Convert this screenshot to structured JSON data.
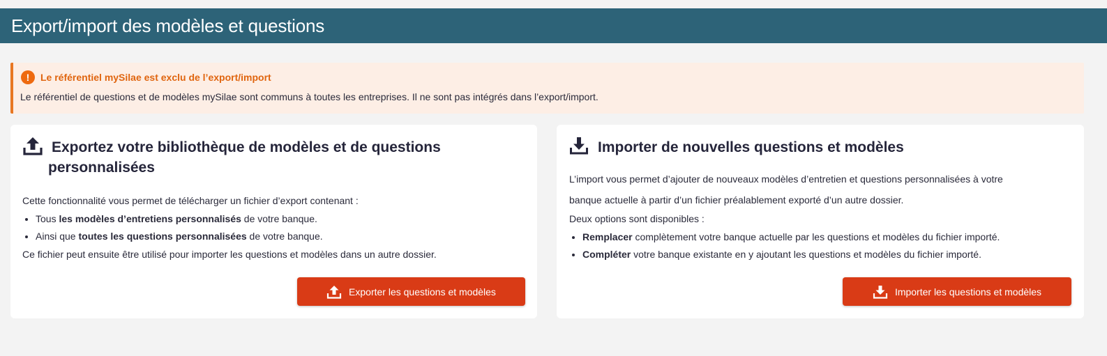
{
  "header": {
    "title": "Export/import des modèles et questions"
  },
  "alert": {
    "title": "Le référentiel mySilae est exclu de l’export/import",
    "text": "Le référentiel de questions et de modèles mySilae sont communs à toutes les entreprises. Il ne sont pas intégrés dans l’export/import.",
    "icon": "exclamation-circle-icon",
    "accent_color": "#e87722"
  },
  "export_card": {
    "icon": "upload-icon",
    "title_line1": "Exportez votre bibliothèque de modèles et de questions",
    "title_line2": "personnalisées",
    "intro": "Cette fonctionnalité vous permet de télécharger un fichier d’export contenant :",
    "items": [
      {
        "prefix": "Tous ",
        "bold": "les modèles d’entretiens personnalisés",
        "suffix": " de votre banque."
      },
      {
        "prefix": "Ainsi que ",
        "bold": "toutes les questions personnalisées",
        "suffix": " de votre banque."
      }
    ],
    "outro": "Ce fichier peut ensuite être utilisé pour importer les questions et modèles dans un autre dossier.",
    "button_label": "Exporter les questions et modèles",
    "button_icon": "upload-icon"
  },
  "import_card": {
    "icon": "download-icon",
    "title": "Importer de nouvelles questions et modèles",
    "intro_line1": "L’import vous permet d’ajouter de nouveaux modèles d’entretien et questions personnalisées à votre",
    "intro_line2": "banque actuelle à partir d’un fichier préalablement exporté d’un autre dossier.",
    "options_intro": "Deux options sont disponibles :",
    "items": [
      {
        "bold": "Remplacer",
        "suffix": " complètement votre banque actuelle par les questions et modèles du fichier importé."
      },
      {
        "bold": "Compléter",
        "suffix": " votre banque existante en y ajoutant les questions et modèles du fichier importé."
      }
    ],
    "button_label": "Importer les questions et modèles",
    "button_icon": "download-icon"
  },
  "colors": {
    "header_bg": "#2d6378",
    "button_bg": "#d93b16",
    "alert_bg": "#fdeee5"
  }
}
